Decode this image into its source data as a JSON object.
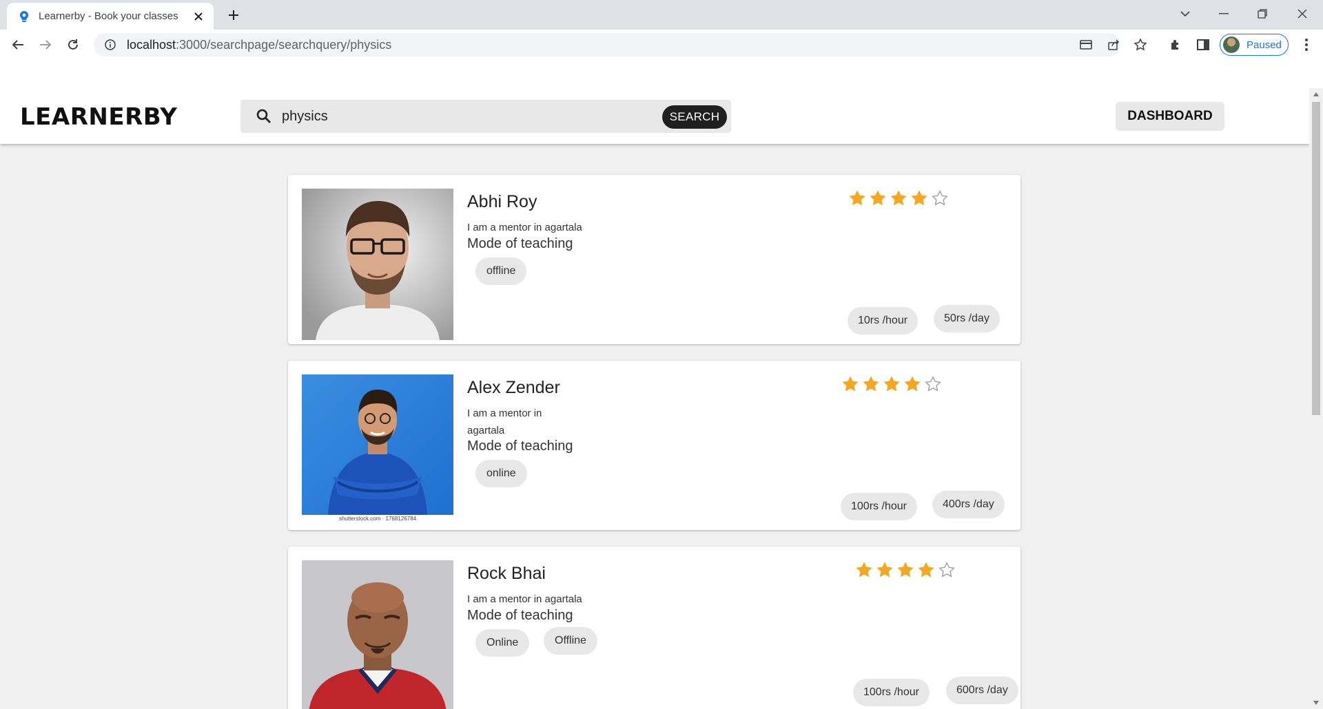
{
  "browser": {
    "tab_title": "Learnerby - Book your classes",
    "url_host": "localhost",
    "url_path": ":3000/searchpage/searchquery/physics",
    "profile_label": "Paused"
  },
  "app": {
    "logo": "LEARNERBY",
    "search": {
      "value": "physics",
      "button_label": "SEARCH"
    },
    "dashboard_label": "DASHBOARD"
  },
  "mentors": [
    {
      "name": "Abhi Roy",
      "bio": "I am a mentor in agartala",
      "mode_label": "Mode of teaching",
      "modes": [
        "offline"
      ],
      "rating": 4,
      "rating_max": 5,
      "price_hour": "10rs /hour",
      "price_day": "50rs /day"
    },
    {
      "name": "Alex Zender",
      "bio": "I am a mentor in agartala",
      "mode_label": "Mode of teaching",
      "modes": [
        "online"
      ],
      "rating": 4,
      "rating_max": 5,
      "price_hour": "100rs /hour",
      "price_day": "400rs /day",
      "photo_caption": "shutterstock.com · 1768126784"
    },
    {
      "name": "Rock Bhai",
      "bio": "I am a mentor in agartala",
      "mode_label": "Mode of teaching",
      "modes": [
        "Online",
        "Offline"
      ],
      "rating": 4,
      "rating_max": 5,
      "price_hour": "100rs /hour",
      "price_day": "600rs /day"
    }
  ],
  "colors": {
    "star_filled": "#f5a623",
    "star_empty": "#9e9e9e",
    "page_bg": "#f0f0f0",
    "chip_bg": "#e8e8e8",
    "search_button_bg": "#1f1f1f"
  }
}
